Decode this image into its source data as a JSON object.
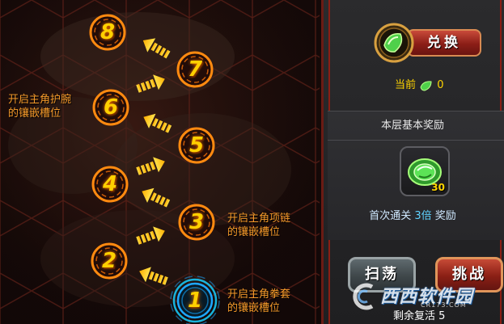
{
  "stages": [
    {
      "number": "1",
      "state": "current"
    },
    {
      "number": "2",
      "state": "locked"
    },
    {
      "number": "3",
      "state": "locked"
    },
    {
      "number": "4",
      "state": "locked"
    },
    {
      "number": "5",
      "state": "locked"
    },
    {
      "number": "6",
      "state": "locked"
    },
    {
      "number": "7",
      "state": "locked"
    },
    {
      "number": "8",
      "state": "locked"
    }
  ],
  "hints": {
    "stage6": {
      "line1": "开启主角护腕",
      "line2": "的镶嵌槽位"
    },
    "stage3": {
      "line1": "开启主角项链",
      "line2": "的镶嵌槽位"
    },
    "stage1": {
      "line1": "开启主角拳套",
      "line2": "的镶嵌槽位"
    }
  },
  "panel": {
    "redeem_label": "兑换",
    "current_label": "当前",
    "current_value": "0",
    "reward_title": "本层基本奖励",
    "reward_count": "30",
    "first_clear_prefix": "首次通关",
    "first_clear_multiplier": "3倍",
    "first_clear_suffix": "奖励",
    "sweep_label": "扫荡",
    "challenge_label": "挑战",
    "revive_label": "剩余复活",
    "revive_count": "5"
  },
  "watermark": {
    "text": "西西软件园",
    "sub": "CR173.COM"
  },
  "colors": {
    "stage_number": "#ffd000",
    "node_ring": "#ff8a10",
    "current_ring": "#1ea8ff",
    "hint_text": "#f59a2a",
    "panel_border": "#8a1e14",
    "gem": "#4fd04a",
    "currency_text": "#ffd400"
  },
  "icons": {
    "medallion": "green-gem-medallion-icon",
    "currency": "green-leaf-gem-icon",
    "reward": "green-gem-icon",
    "path_arrow": "chevron-arrow-icon",
    "watermark_logo": "cc-logo-icon"
  }
}
